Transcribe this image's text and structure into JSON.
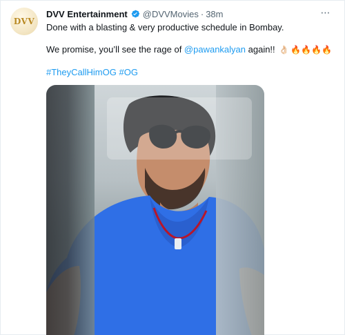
{
  "tweet": {
    "author_name": "DVV Entertainment",
    "handle": "@DVVMovies",
    "separator": "·",
    "time": "38m",
    "avatar_text": "DVV",
    "verified_icon": "verified-badge-icon",
    "more_icon": "more-horizontal-icon",
    "text_line1": "Done with a blasting & very productive schedule in Bombay.",
    "text_line2_prefix": "We promise, you’ll see the rage of ",
    "mention": "@pawankalyan",
    "text_line2_suffix": " again!! ",
    "emojis": {
      "hand": "👌🏻",
      "fire": "🔥🔥🔥🔥"
    },
    "hashtags": [
      "#TheyCallHimOG",
      "#OG"
    ]
  },
  "colors": {
    "link": "#1d9bf0",
    "text": "#0f1419",
    "muted": "#536471",
    "verified": "#1d9bf0",
    "media_shirt": "#2f6fe6"
  }
}
